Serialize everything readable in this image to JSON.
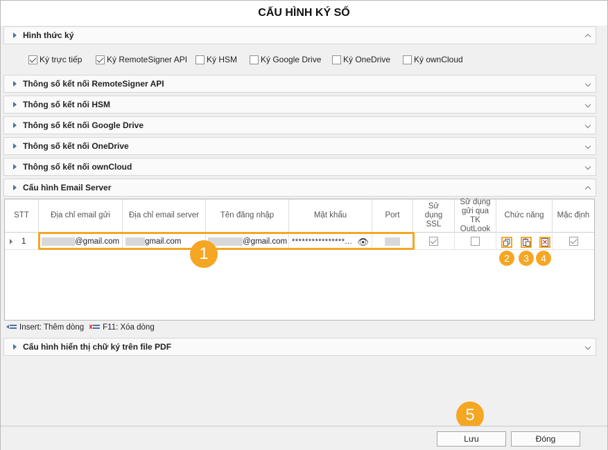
{
  "window": {
    "title": "CẤU HÌNH KÝ SỐ"
  },
  "sections": {
    "signing_methods": "Hình thức ký",
    "remote_signer": "Thông số kết nối RemoteSigner API",
    "hsm": "Thông số kết nối HSM",
    "google_drive": "Thông số kết nối Google Drive",
    "onedrive": "Thông số kết nối OneDrive",
    "owncloud": "Thông số kết nối ownCloud",
    "email_server": "Cấu hình Email Server",
    "pdf_display": "Cấu hình hiển thị chữ ký trên file PDF"
  },
  "signing_options": [
    {
      "label": "Ký trực tiếp",
      "checked": true
    },
    {
      "label": "Ký RemoteSigner API",
      "checked": true
    },
    {
      "label": "Ký HSM",
      "checked": false
    },
    {
      "label": "Ký Google Drive",
      "checked": false
    },
    {
      "label": "Ký OneDrive",
      "checked": false
    },
    {
      "label": "Ký ownCloud",
      "checked": false
    }
  ],
  "grid": {
    "headers": {
      "stt": "STT",
      "sender_email": "Địa chỉ email gửi",
      "server_email": "Địa chỉ email server",
      "username": "Tên đăng nhập",
      "password": "Mật khẩu",
      "port": "Port",
      "ssl": "Sử dụng SSL",
      "outlook": "Sử dụng gửi qua TK OutLook",
      "functions": "Chức năng",
      "default": "Mặc định"
    },
    "rows": [
      {
        "stt": "1",
        "sender_email": "@gmail.com",
        "server_email": "gmail.com",
        "username": "@gmail.com",
        "password": "****************...",
        "ssl": true,
        "outlook": false,
        "default": true
      }
    ]
  },
  "shortcuts": {
    "insert": "Insert: Thêm dòng",
    "delete": "F11: Xóa dòng"
  },
  "badges": {
    "b1": "1",
    "b2": "2",
    "b3": "3",
    "b4": "4",
    "b5": "5"
  },
  "buttons": {
    "save": "Lưu",
    "close": "Đóng"
  },
  "colors": {
    "accent": "#f5a623",
    "arrow": "#4a6fa5"
  }
}
